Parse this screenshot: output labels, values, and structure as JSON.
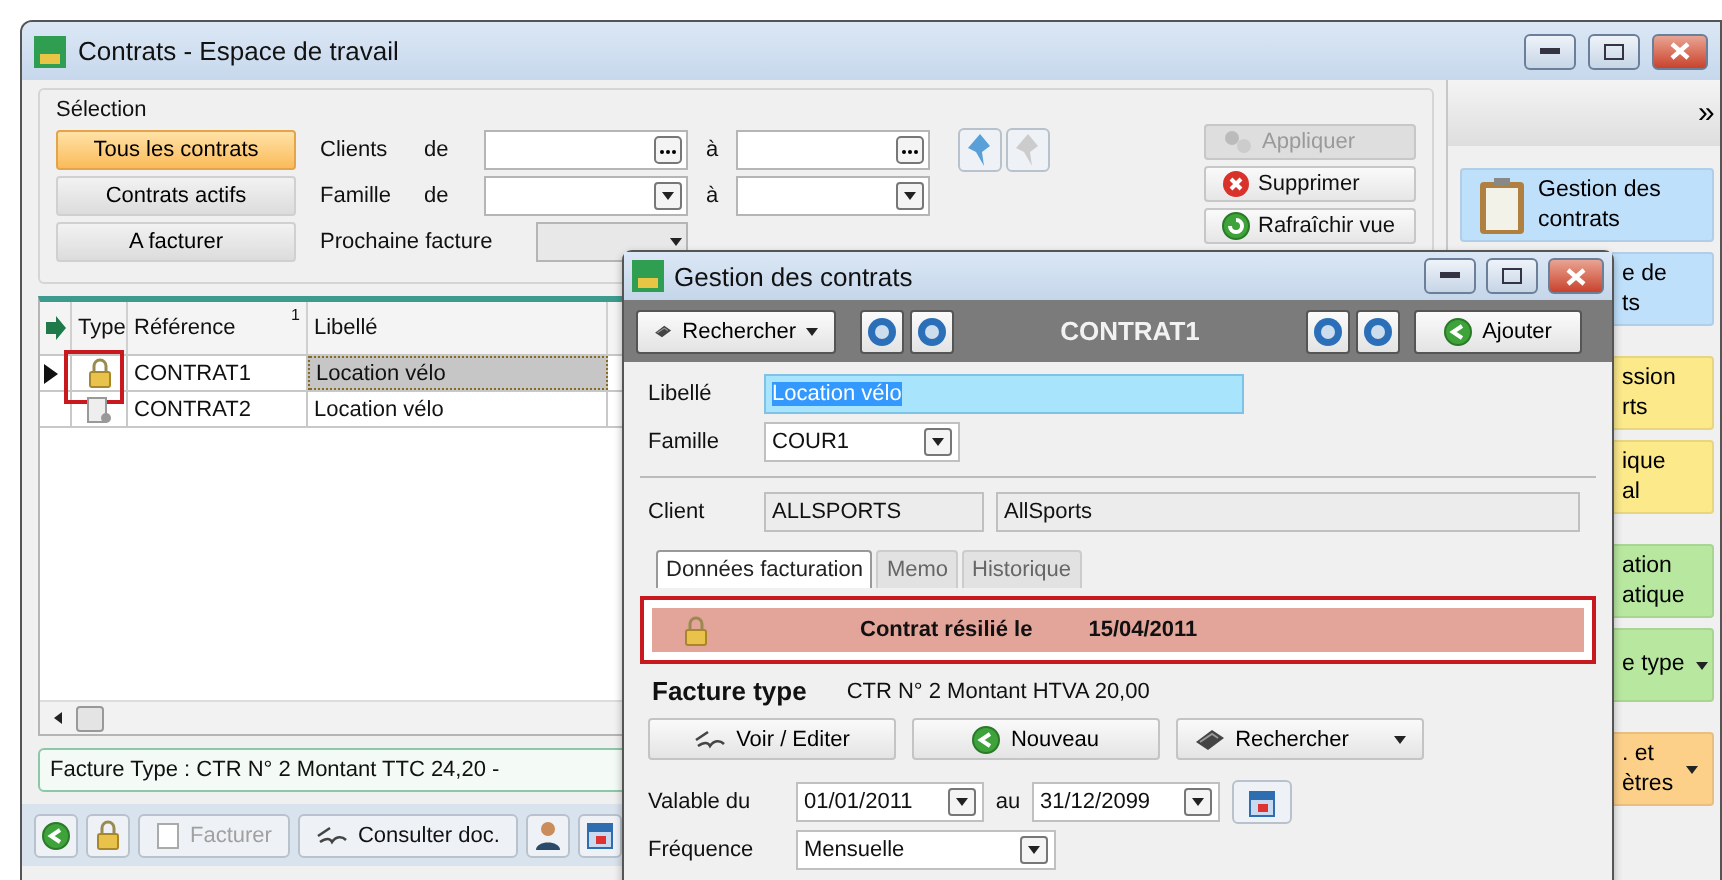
{
  "window": {
    "title": "Contrats - Espace de travail"
  },
  "selection": {
    "legend": "Sélection",
    "filters": [
      {
        "label": "Tous les contrats",
        "selected": true
      },
      {
        "label": "Contrats actifs",
        "selected": false
      },
      {
        "label": "A facturer",
        "selected": false
      }
    ],
    "criteria": [
      {
        "label": "Clients",
        "from": "de",
        "to": "à",
        "kind": "lookup"
      },
      {
        "label": "Famille",
        "from": "de",
        "to": "à",
        "kind": "combo"
      },
      {
        "label": "Prochaine facture",
        "kind": "period"
      }
    ],
    "actions": [
      {
        "label": "Appliquer",
        "disabled": true
      },
      {
        "label": "Supprimer",
        "disabled": false
      },
      {
        "label": "Rafraîchir vue",
        "disabled": false
      }
    ]
  },
  "grid": {
    "columns": [
      "Type",
      "Référence",
      "Libellé"
    ],
    "sort_mark": "1",
    "rows": [
      {
        "reference": "CONTRAT1",
        "label": "Location vélo",
        "current": true,
        "selected": true,
        "locked": true,
        "highlighted": true
      },
      {
        "reference": "CONTRAT2",
        "label": "Location vélo",
        "current": false,
        "selected": false,
        "locked": false,
        "highlighted": false
      }
    ]
  },
  "status": "Facture Type : CTR N° 2 Montant TTC 24,20 -",
  "toolbar": [
    {
      "kind": "icon"
    },
    {
      "kind": "icon"
    },
    {
      "kind": "button",
      "label": "Facturer",
      "disabled": true
    },
    {
      "kind": "button",
      "label": "Consulter doc.",
      "disabled": false
    },
    {
      "kind": "icon"
    },
    {
      "kind": "icon"
    }
  ],
  "sidebar": {
    "toggle": "»",
    "items": [
      {
        "lines": [
          "Gestion des",
          "contrats"
        ],
        "color": "#bfe0fb"
      },
      {
        "lines": [
          "e de",
          "ts"
        ],
        "color": "#bfe0fb"
      },
      {
        "lines": [
          "ssion",
          "rts"
        ],
        "color": "#fbe98a"
      },
      {
        "lines": [
          "ique",
          "al"
        ],
        "color": "#fbe98a"
      },
      {
        "lines": [
          "ation",
          "atique"
        ],
        "color": "#b8e8a0"
      },
      {
        "lines": [
          "e type"
        ],
        "color": "#b8e8a0"
      },
      {
        "lines": [
          ". et",
          "ètres"
        ],
        "color": "#fdd08a"
      }
    ]
  },
  "dialog": {
    "title": "Gestion des contrats",
    "search_button": "Rechercher",
    "record": "CONTRAT1",
    "add_button": "Ajouter",
    "form": [
      {
        "label": "Libellé",
        "value": "Location vélo",
        "kind": "text",
        "selected": true
      },
      {
        "label": "Famille",
        "value": "COUR1",
        "kind": "combo",
        "selected": false
      }
    ],
    "client": {
      "label": "Client",
      "code": "ALLSPORTS",
      "name": "AllSports"
    },
    "tabs": [
      {
        "label": "Données facturation",
        "selected": true
      },
      {
        "label": "Memo",
        "selected": false
      },
      {
        "label": "Historique",
        "selected": false
      }
    ],
    "banner": {
      "text": "Contrat résilié le",
      "date": "15/04/2011",
      "highlighted": true
    },
    "invoice_type": {
      "label": "Facture type",
      "value": "CTR N° 2 Montant HTVA 20,00"
    },
    "buttons": [
      {
        "label": "Voir / Editer"
      },
      {
        "label": "Nouveau"
      },
      {
        "label": "Rechercher"
      }
    ],
    "validity": {
      "label": "Valable du",
      "from": "01/01/2011",
      "between": "au",
      "to": "31/12/2099"
    },
    "frequency": {
      "label": "Fréquence",
      "value": "Mensuelle"
    }
  }
}
